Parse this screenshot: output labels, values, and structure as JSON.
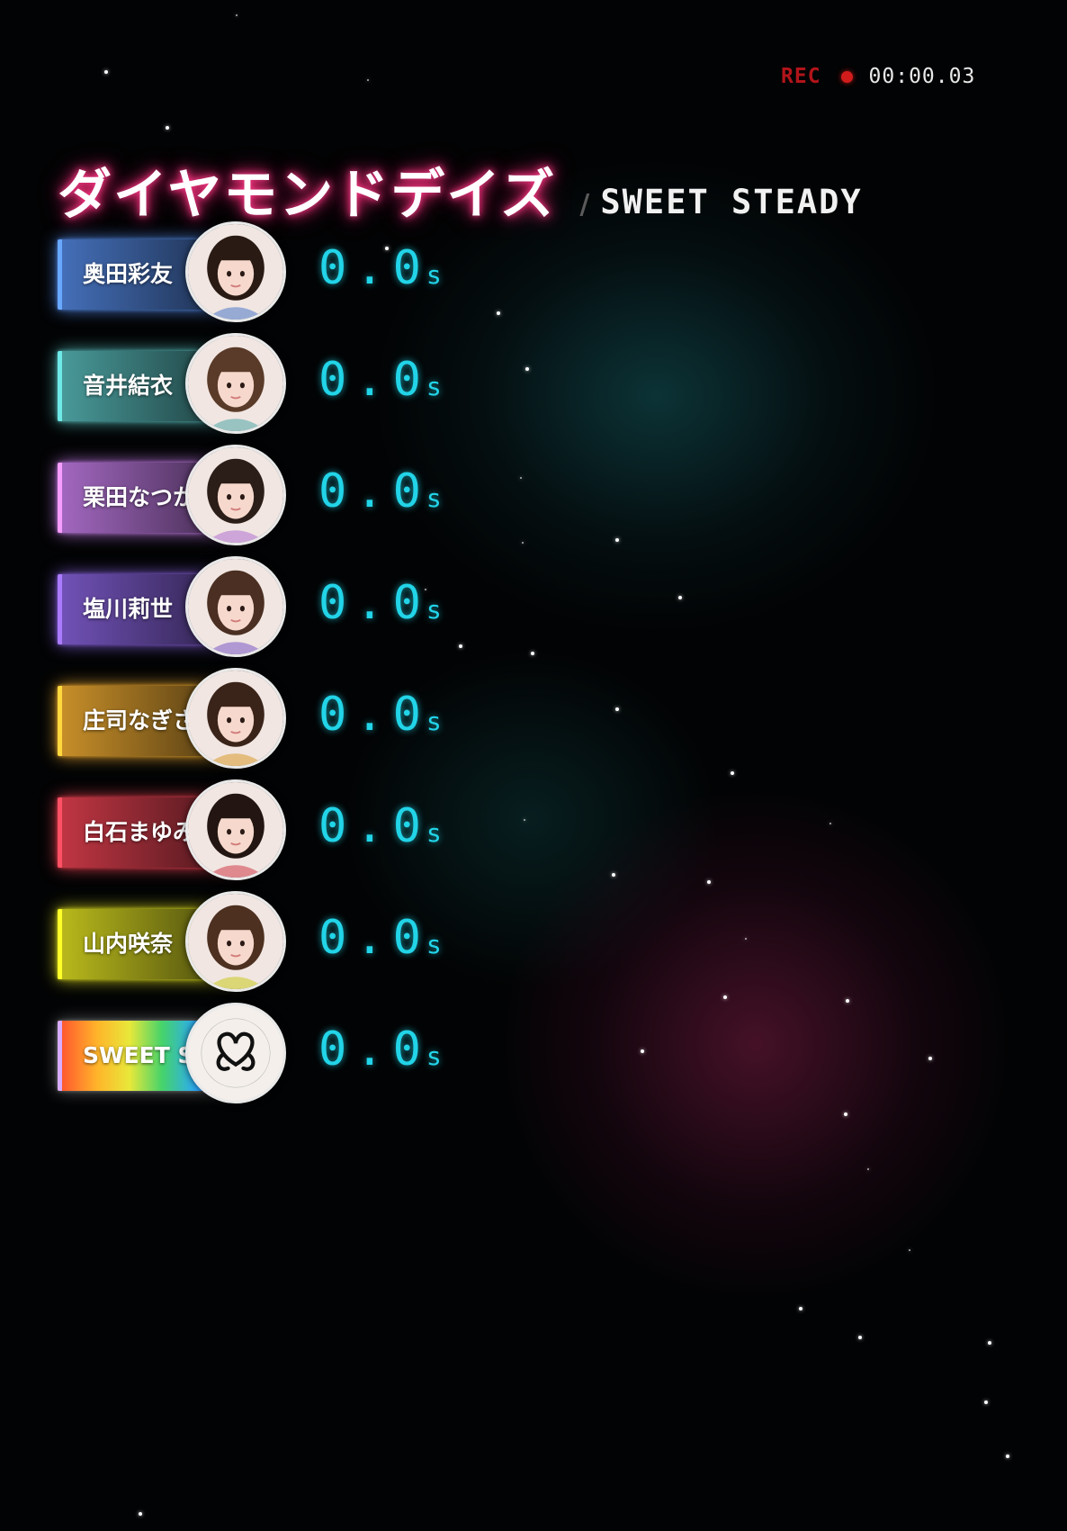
{
  "recorder": {
    "label": "REC",
    "time": "00:00.03"
  },
  "title": {
    "song": "ダイヤモンドデイズ",
    "separator": "/",
    "artist": "SWEET STEADY"
  },
  "members": [
    {
      "name": "奥田彩友",
      "time": "0.0",
      "unit": "s",
      "color": "#4a78c8"
    },
    {
      "name": "音井結衣",
      "time": "0.0",
      "unit": "s",
      "color": "#4fa6a6"
    },
    {
      "name": "栗田なつか",
      "time": "0.0",
      "unit": "s",
      "color": "#b070d0"
    },
    {
      "name": "塩川莉世",
      "time": "0.0",
      "unit": "s",
      "color": "#7a58c6"
    },
    {
      "name": "庄司なぎさ",
      "time": "0.0",
      "unit": "s",
      "color": "#d89a2c"
    },
    {
      "name": "白石まゆみ",
      "time": "0.0",
      "unit": "s",
      "color": "#d03a48"
    },
    {
      "name": "山内咲奈",
      "time": "0.0",
      "unit": "s",
      "color": "#c8c81e"
    },
    {
      "name": "SWEET STEADY",
      "time": "0.0",
      "unit": "s",
      "color": "rainbow"
    }
  ]
}
